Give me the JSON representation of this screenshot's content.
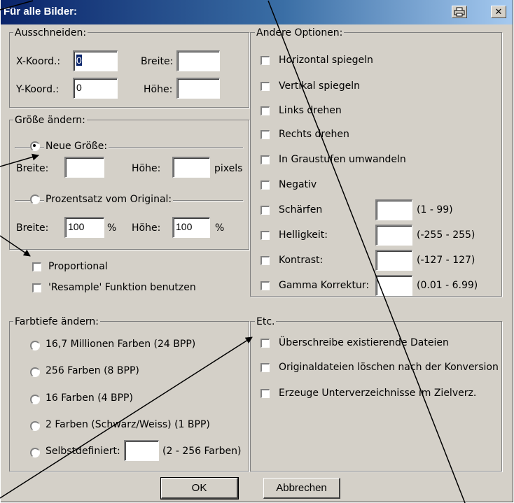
{
  "window": {
    "title": "Für alle Bilder:",
    "title_icon": "print-icon",
    "close_glyph": "✕"
  },
  "crop": {
    "title": "Ausschneiden:",
    "x_label": "X-Koord.:",
    "x_value": "0",
    "w_label": "Breite:",
    "w_value": "",
    "y_label": "Y-Koord.:",
    "y_value": "0",
    "h_label": "Höhe:",
    "h_value": ""
  },
  "resize": {
    "title": "Größe ändern:",
    "new_size_label": "Neue Größe:",
    "ns_w_label": "Breite:",
    "ns_w_value": "",
    "ns_h_label": "Höhe:",
    "ns_h_value": "",
    "ns_unit": "pixels",
    "percent_label": "Prozentsatz vom Original:",
    "p_w_label": "Breite:",
    "p_w_value": "100",
    "p_w_unit": "%",
    "p_h_label": "Höhe:",
    "p_h_value": "100",
    "p_h_unit": "%",
    "selected": "new_size"
  },
  "resize_options": {
    "proportional": "Proportional",
    "resample": "'Resample' Funktion benutzen"
  },
  "other": {
    "title": "Andere Optionen:",
    "flip_h": "Horizontal spiegeln",
    "flip_v": "Vertikal spiegeln",
    "rot_l": "Links drehen",
    "rot_r": "Rechts drehen",
    "gray": "In Graustufen umwandeln",
    "negative": "Negativ",
    "sharpen": "Schärfen",
    "sharpen_value": "",
    "sharpen_range": "(1 - 99)",
    "brightness": "Helligkeit:",
    "brightness_value": "",
    "brightness_range": "(-255 - 255)",
    "contrast": "Kontrast:",
    "contrast_value": "",
    "contrast_range": "(-127 - 127)",
    "gamma": "Gamma Korrektur:",
    "gamma_value": "",
    "gamma_range": "(0.01 - 6.99)"
  },
  "color_depth": {
    "title": "Farbtiefe ändern:",
    "c24": "16,7 Millionen Farben (24 BPP)",
    "c256": "256 Farben (8 BPP)",
    "c16": "16 Farben (4 BPP)",
    "c2": "2 Farben (Schwarz/Weiss) (1 BPP)",
    "custom": "Selbstdefiniert:",
    "custom_value": "",
    "custom_range": "(2 - 256 Farben)"
  },
  "etc": {
    "title": "Etc.",
    "overwrite": "Überschreibe existierende Dateien",
    "delete_orig": "Originaldateien löschen nach der Konversion",
    "subdirs": "Erzeuge Unterverzeichnisse im Zielverz."
  },
  "buttons": {
    "ok": "OK",
    "cancel": "Abbrechen"
  }
}
